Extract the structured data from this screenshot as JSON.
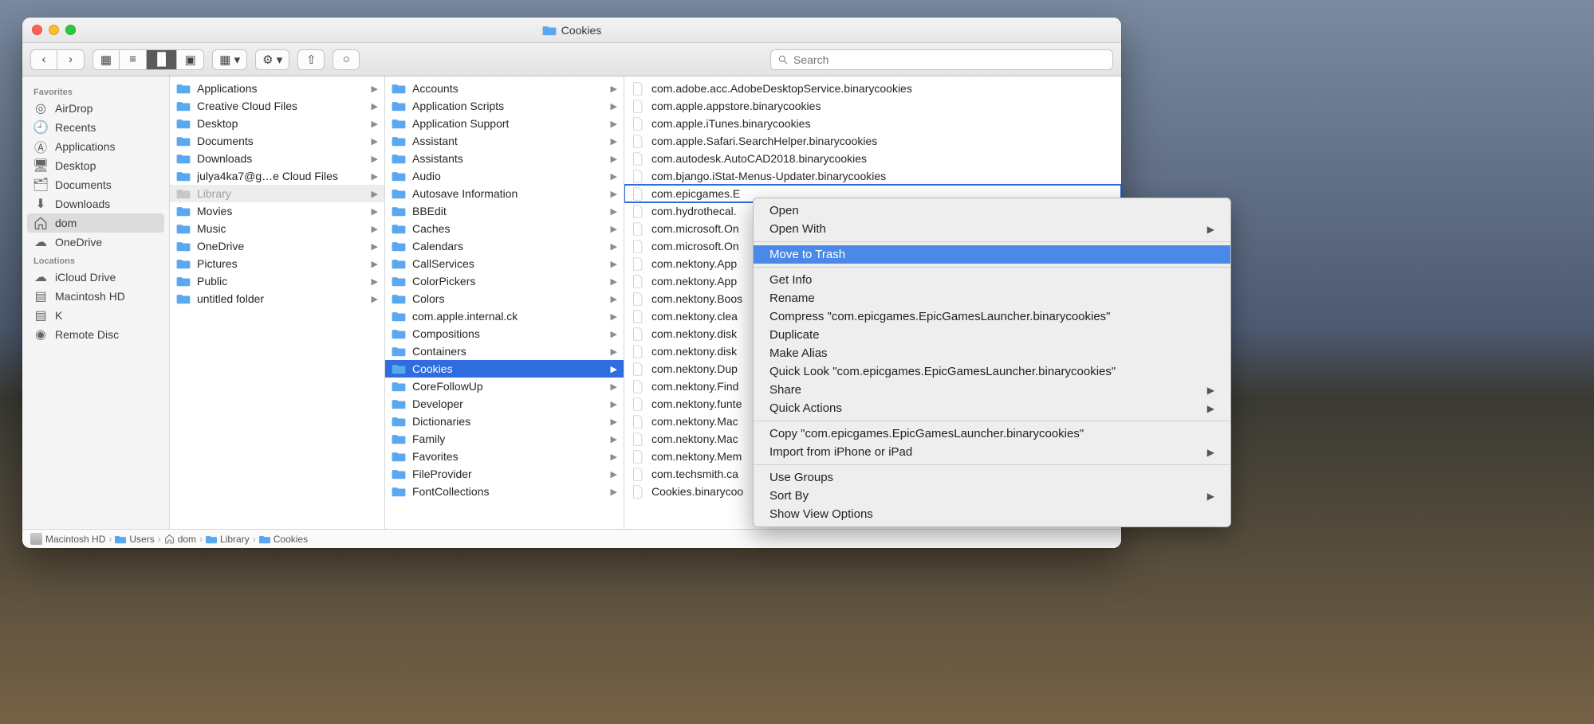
{
  "window": {
    "title": "Cookies"
  },
  "search": {
    "placeholder": "Search"
  },
  "sidebar": {
    "sections": [
      {
        "label": "Favorites",
        "items": [
          {
            "icon": "airdrop",
            "label": "AirDrop"
          },
          {
            "icon": "recents",
            "label": "Recents"
          },
          {
            "icon": "apps",
            "label": "Applications"
          },
          {
            "icon": "desktop",
            "label": "Desktop"
          },
          {
            "icon": "documents",
            "label": "Documents"
          },
          {
            "icon": "downloads",
            "label": "Downloads"
          },
          {
            "icon": "home",
            "label": "dom",
            "selected": true
          },
          {
            "icon": "onedrive",
            "label": "OneDrive"
          }
        ]
      },
      {
        "label": "Locations",
        "items": [
          {
            "icon": "icloud",
            "label": "iCloud Drive"
          },
          {
            "icon": "hd",
            "label": "Macintosh HD"
          },
          {
            "icon": "hd",
            "label": "K"
          },
          {
            "icon": "disc",
            "label": "Remote Disc"
          }
        ]
      }
    ]
  },
  "columns": [
    {
      "items": [
        {
          "label": "Applications",
          "type": "folder",
          "arrow": true
        },
        {
          "label": "Creative Cloud Files",
          "type": "folder",
          "arrow": true
        },
        {
          "label": "Desktop",
          "type": "folder",
          "arrow": true
        },
        {
          "label": "Documents",
          "type": "folder",
          "arrow": true
        },
        {
          "label": "Downloads",
          "type": "folder",
          "arrow": true
        },
        {
          "label": "julya4ka7@g…e Cloud Files",
          "type": "folder",
          "arrow": true
        },
        {
          "label": "Library",
          "type": "folder",
          "arrow": true,
          "muted": true,
          "active": true
        },
        {
          "label": "Movies",
          "type": "folder",
          "arrow": true
        },
        {
          "label": "Music",
          "type": "folder",
          "arrow": true
        },
        {
          "label": "OneDrive",
          "type": "folder",
          "arrow": true
        },
        {
          "label": "Pictures",
          "type": "folder",
          "arrow": true
        },
        {
          "label": "Public",
          "type": "folder",
          "arrow": true
        },
        {
          "label": "untitled folder",
          "type": "folder",
          "arrow": true
        }
      ]
    },
    {
      "items": [
        {
          "label": "Accounts",
          "type": "folder",
          "arrow": true
        },
        {
          "label": "Application Scripts",
          "type": "folder",
          "arrow": true
        },
        {
          "label": "Application Support",
          "type": "folder",
          "arrow": true
        },
        {
          "label": "Assistant",
          "type": "folder",
          "arrow": true
        },
        {
          "label": "Assistants",
          "type": "folder",
          "arrow": true
        },
        {
          "label": "Audio",
          "type": "folder",
          "arrow": true
        },
        {
          "label": "Autosave Information",
          "type": "folder",
          "arrow": true
        },
        {
          "label": "BBEdit",
          "type": "folder",
          "arrow": true
        },
        {
          "label": "Caches",
          "type": "folder",
          "arrow": true
        },
        {
          "label": "Calendars",
          "type": "folder",
          "arrow": true
        },
        {
          "label": "CallServices",
          "type": "folder",
          "arrow": true
        },
        {
          "label": "ColorPickers",
          "type": "folder",
          "arrow": true
        },
        {
          "label": "Colors",
          "type": "folder",
          "arrow": true
        },
        {
          "label": "com.apple.internal.ck",
          "type": "folder",
          "arrow": true
        },
        {
          "label": "Compositions",
          "type": "folder",
          "arrow": true
        },
        {
          "label": "Containers",
          "type": "folder",
          "arrow": true
        },
        {
          "label": "Cookies",
          "type": "folder",
          "arrow": true,
          "selected": true
        },
        {
          "label": "CoreFollowUp",
          "type": "folder",
          "arrow": true
        },
        {
          "label": "Developer",
          "type": "folder",
          "arrow": true
        },
        {
          "label": "Dictionaries",
          "type": "folder",
          "arrow": true
        },
        {
          "label": "Family",
          "type": "folder",
          "arrow": true
        },
        {
          "label": "Favorites",
          "type": "folder",
          "arrow": true
        },
        {
          "label": "FileProvider",
          "type": "folder",
          "arrow": true
        },
        {
          "label": "FontCollections",
          "type": "folder",
          "arrow": true
        }
      ]
    },
    {
      "items": [
        {
          "label": "com.adobe.acc.AdobeDesktopService.binarycookies",
          "type": "file"
        },
        {
          "label": "com.apple.appstore.binarycookies",
          "type": "file"
        },
        {
          "label": "com.apple.iTunes.binarycookies",
          "type": "file"
        },
        {
          "label": "com.apple.Safari.SearchHelper.binarycookies",
          "type": "file"
        },
        {
          "label": "com.autodesk.AutoCAD2018.binarycookies",
          "type": "file"
        },
        {
          "label": "com.bjango.iStat-Menus-Updater.binarycookies",
          "type": "file"
        },
        {
          "label": "com.epicgames.E",
          "type": "file",
          "highlight": true
        },
        {
          "label": "com.hydrothecal.",
          "type": "file"
        },
        {
          "label": "com.microsoft.On",
          "type": "file"
        },
        {
          "label": "com.microsoft.On",
          "type": "file"
        },
        {
          "label": "com.nektony.App",
          "type": "file"
        },
        {
          "label": "com.nektony.App",
          "type": "file"
        },
        {
          "label": "com.nektony.Boos",
          "type": "file"
        },
        {
          "label": "com.nektony.clea",
          "type": "file"
        },
        {
          "label": "com.nektony.disk",
          "type": "file"
        },
        {
          "label": "com.nektony.disk",
          "type": "file"
        },
        {
          "label": "com.nektony.Dup",
          "type": "file"
        },
        {
          "label": "com.nektony.Find",
          "type": "file"
        },
        {
          "label": "com.nektony.funte",
          "type": "file"
        },
        {
          "label": "com.nektony.Mac",
          "type": "file"
        },
        {
          "label": "com.nektony.Mac",
          "type": "file"
        },
        {
          "label": "com.nektony.Mem",
          "type": "file"
        },
        {
          "label": "com.techsmith.ca",
          "type": "file"
        },
        {
          "label": "Cookies.binarycoo",
          "type": "file"
        }
      ]
    }
  ],
  "pathbar": [
    {
      "icon": "hd",
      "label": "Macintosh HD"
    },
    {
      "icon": "folder",
      "label": "Users"
    },
    {
      "icon": "home",
      "label": "dom"
    },
    {
      "icon": "folder",
      "label": "Library"
    },
    {
      "icon": "folder",
      "label": "Cookies"
    }
  ],
  "context_menu": {
    "groups": [
      [
        "Open",
        {
          "label": "Open With",
          "sub": true
        }
      ],
      [
        {
          "label": "Move to Trash",
          "selected": true
        }
      ],
      [
        "Get Info",
        "Rename",
        "Compress \"com.epicgames.EpicGamesLauncher.binarycookies\"",
        "Duplicate",
        "Make Alias",
        "Quick Look \"com.epicgames.EpicGamesLauncher.binarycookies\"",
        {
          "label": "Share",
          "sub": true
        },
        {
          "label": "Quick Actions",
          "sub": true
        }
      ],
      [
        "Copy \"com.epicgames.EpicGamesLauncher.binarycookies\"",
        {
          "label": "Import from iPhone or iPad",
          "sub": true
        }
      ],
      [
        "Use Groups",
        {
          "label": "Sort By",
          "sub": true
        },
        "Show View Options"
      ]
    ]
  }
}
